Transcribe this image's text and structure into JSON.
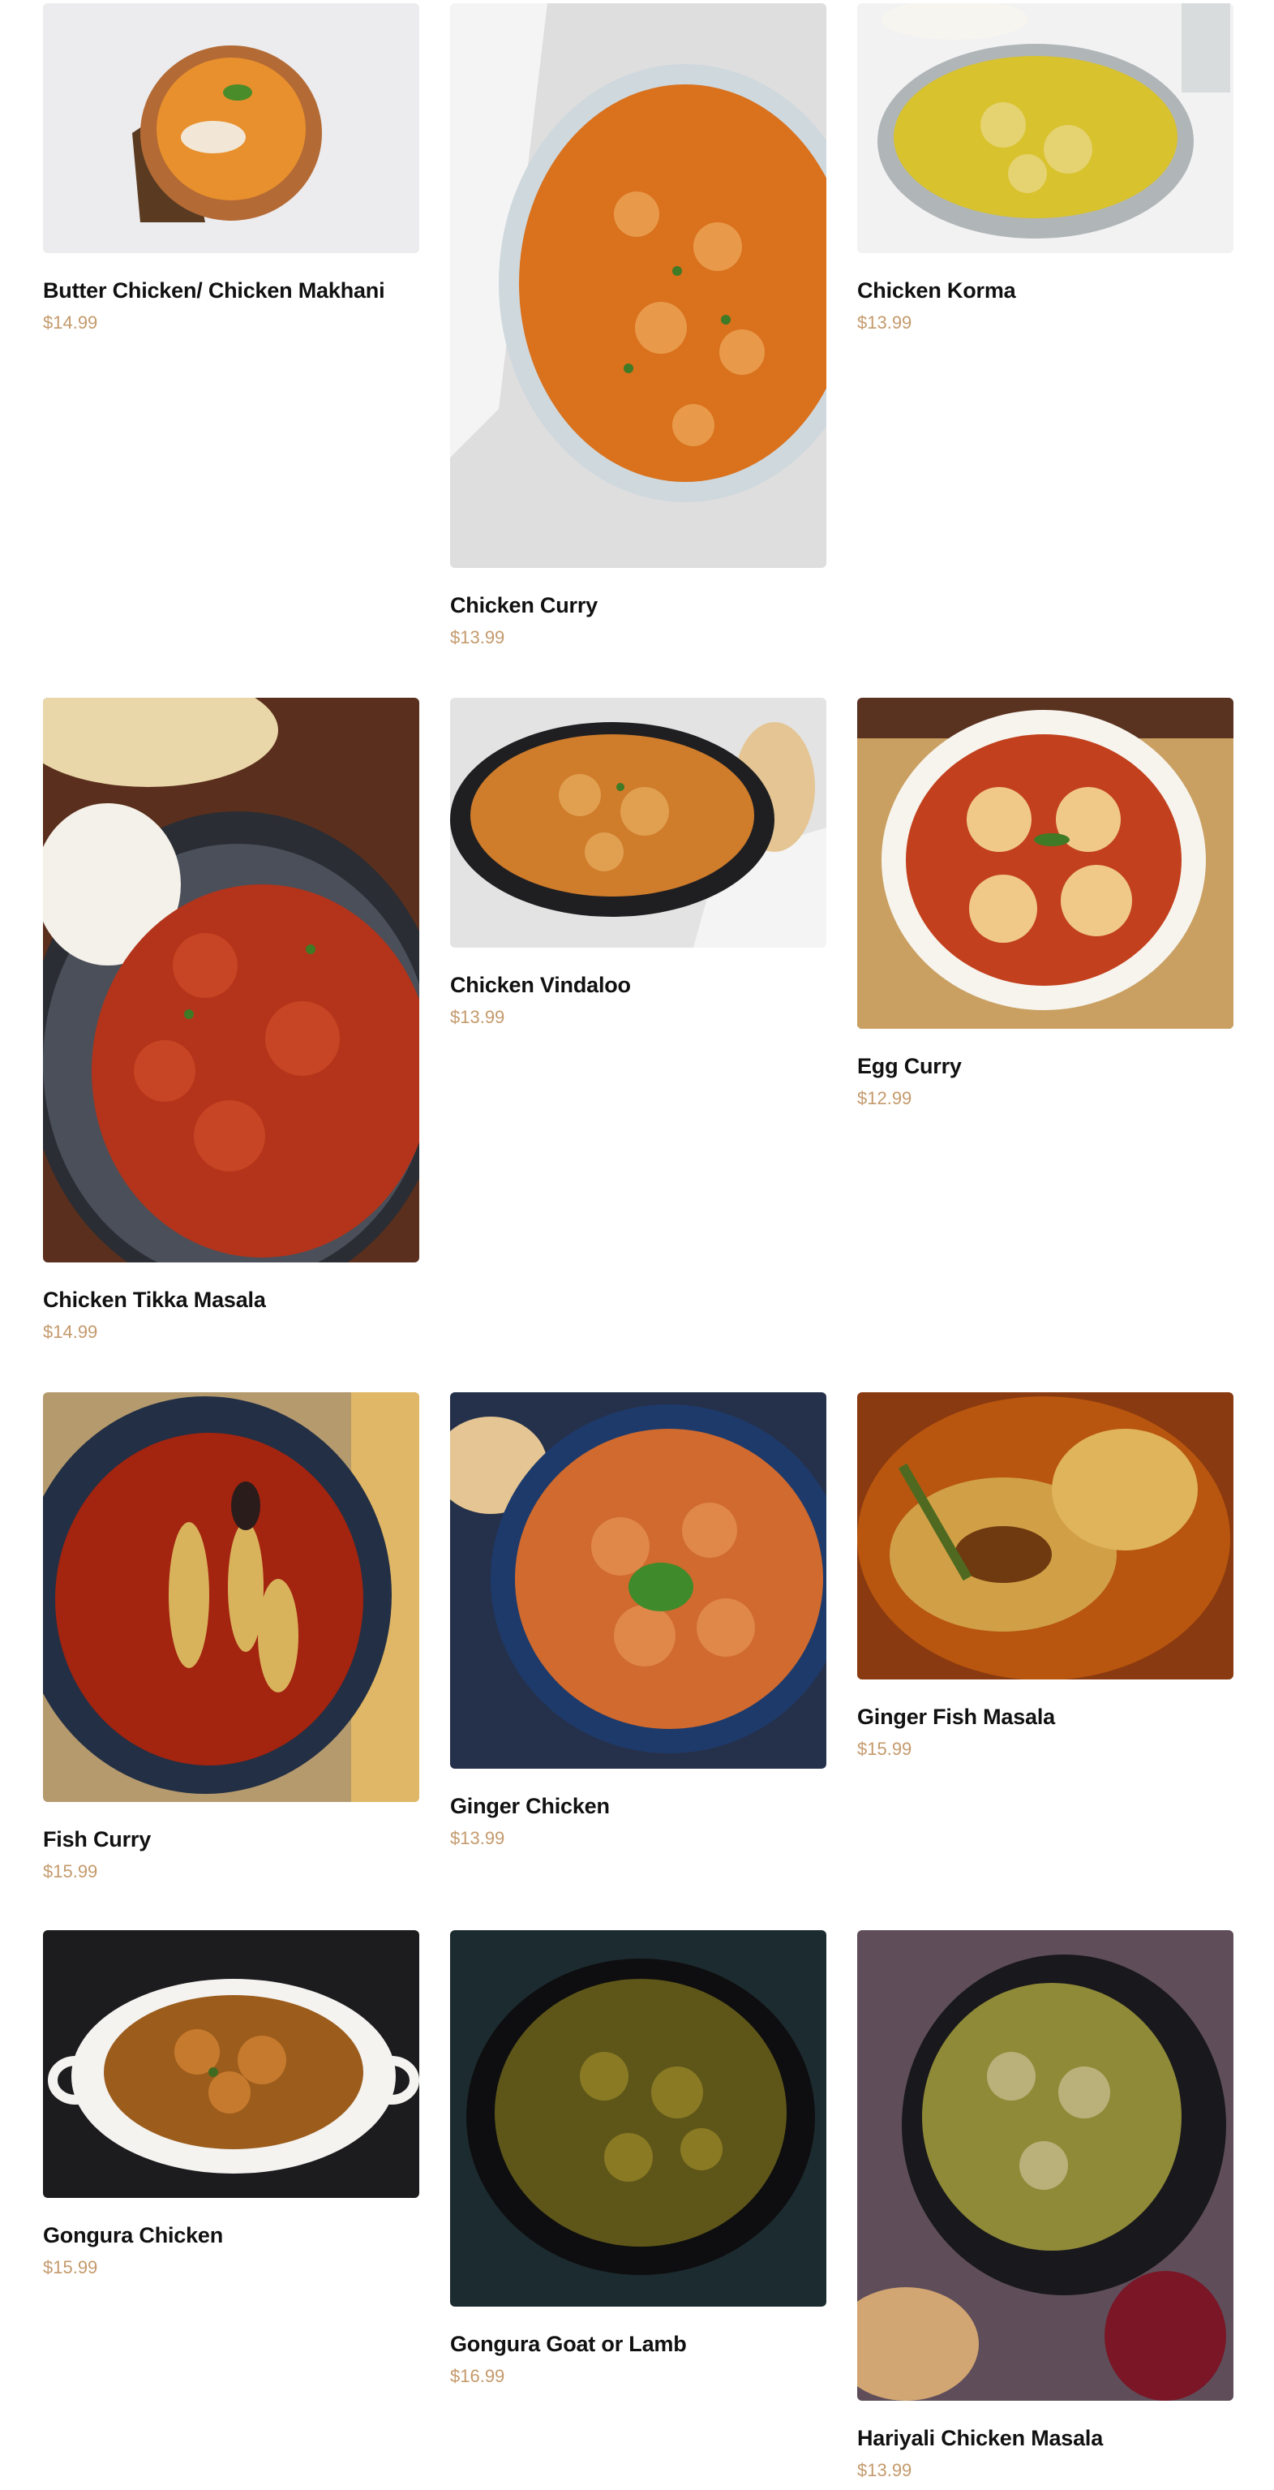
{
  "menu": {
    "items": [
      {
        "name": "Butter Chicken/ Chicken Makhani",
        "price": "$14.99"
      },
      {
        "name": "Chicken Curry",
        "price": "$13.99"
      },
      {
        "name": "Chicken Korma",
        "price": "$13.99"
      },
      {
        "name": "Chicken Tikka Masala",
        "price": "$14.99"
      },
      {
        "name": "Chicken Vindaloo",
        "price": "$13.99"
      },
      {
        "name": "Egg Curry",
        "price": "$12.99"
      },
      {
        "name": "Fish Curry",
        "price": "$15.99"
      },
      {
        "name": "Ginger Chicken",
        "price": "$13.99"
      },
      {
        "name": "Ginger Fish Masala",
        "price": "$15.99"
      },
      {
        "name": "Gongura Chicken",
        "price": "$15.99"
      },
      {
        "name": "Gongura Goat or Lamb",
        "price": "$16.99"
      },
      {
        "name": "Hariyali Chicken Masala",
        "price": "$13.99"
      }
    ]
  },
  "colors": {
    "price": "#c49a6c",
    "name": "#111111"
  }
}
